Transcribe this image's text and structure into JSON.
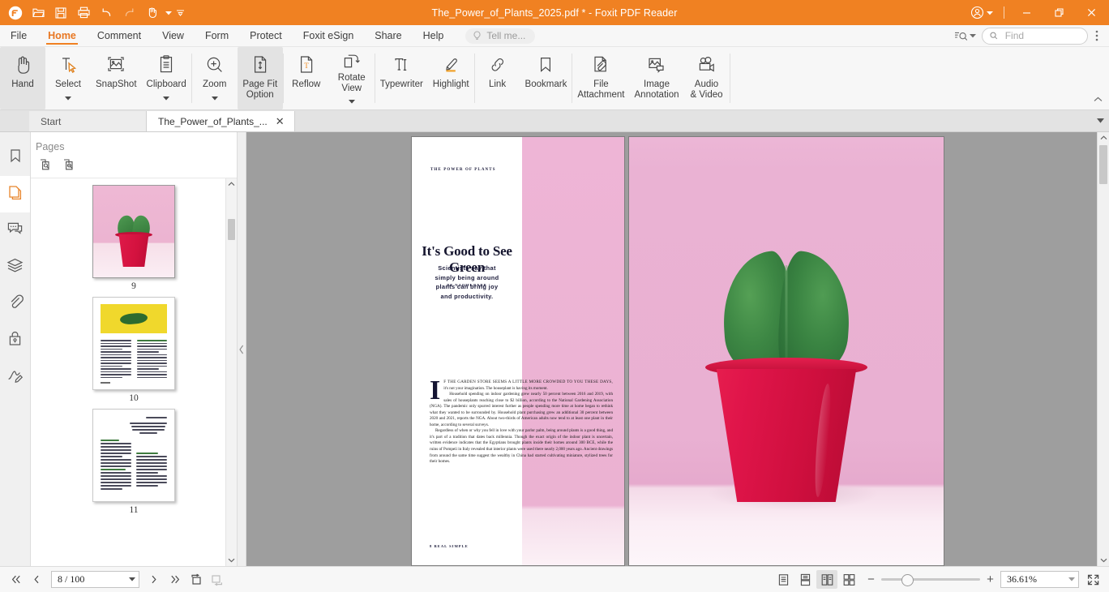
{
  "titlebar": {
    "doc_title": "The_Power_of_Plants_2025.pdf * - Foxit PDF Reader",
    "accent_color": "#f08122",
    "quick_access": [
      {
        "name": "foxit-logo-icon",
        "label": "Foxit"
      },
      {
        "name": "open-icon",
        "label": "Open"
      },
      {
        "name": "save-icon",
        "label": "Save"
      },
      {
        "name": "print-icon",
        "label": "Print"
      },
      {
        "name": "undo-icon",
        "label": "Undo"
      },
      {
        "name": "redo-icon",
        "label": "Redo"
      },
      {
        "name": "hand-tool-icon",
        "label": "Hand Tool"
      },
      {
        "name": "customize-quick-access-icon",
        "label": "Customize"
      }
    ],
    "window_controls": [
      {
        "name": "account-icon",
        "label": "Account"
      },
      {
        "name": "minimize-button",
        "label": "Minimize"
      },
      {
        "name": "restore-button",
        "label": "Restore"
      },
      {
        "name": "close-button",
        "label": "Close"
      }
    ]
  },
  "menubar": {
    "items": [
      {
        "label": "File",
        "active": false
      },
      {
        "label": "Home",
        "active": true
      },
      {
        "label": "Comment",
        "active": false
      },
      {
        "label": "View",
        "active": false
      },
      {
        "label": "Form",
        "active": false
      },
      {
        "label": "Protect",
        "active": false
      },
      {
        "label": "Foxit eSign",
        "active": false
      },
      {
        "label": "Share",
        "active": false
      },
      {
        "label": "Help",
        "active": false
      }
    ],
    "tell_me_placeholder": "Tell me...",
    "find_placeholder": "Find",
    "find_value": ""
  },
  "ribbon": {
    "groups": [
      {
        "buttons": [
          {
            "label": "Hand",
            "icon": "hand-icon",
            "selected": true,
            "caret": false
          },
          {
            "label": "Select",
            "icon": "select-text-icon",
            "selected": false,
            "caret": true
          },
          {
            "label": "SnapShot",
            "icon": "snapshot-icon",
            "selected": false,
            "caret": false
          },
          {
            "label": "Clipboard",
            "icon": "clipboard-icon",
            "selected": false,
            "caret": true
          }
        ]
      },
      {
        "buttons": [
          {
            "label": "Zoom",
            "icon": "zoom-in-icon",
            "selected": false,
            "caret": true
          },
          {
            "label": "Page Fit\nOption",
            "icon": "page-fit-icon",
            "selected": true,
            "caret": true
          }
        ]
      },
      {
        "buttons": [
          {
            "label": "Reflow",
            "icon": "reflow-icon",
            "selected": false,
            "caret": false
          },
          {
            "label": "Rotate\nView",
            "icon": "rotate-view-icon",
            "selected": false,
            "caret": true
          }
        ]
      },
      {
        "buttons": [
          {
            "label": "Typewriter",
            "icon": "typewriter-icon",
            "selected": false,
            "caret": false
          },
          {
            "label": "Highlight",
            "icon": "highlight-icon",
            "selected": false,
            "caret": false
          }
        ]
      },
      {
        "buttons": [
          {
            "label": "Link",
            "icon": "link-icon",
            "selected": false,
            "caret": false
          },
          {
            "label": "Bookmark",
            "icon": "bookmark-icon",
            "selected": false,
            "caret": false
          }
        ]
      },
      {
        "buttons": [
          {
            "label": "File\nAttachment",
            "icon": "file-attachment-icon",
            "selected": false,
            "caret": false
          },
          {
            "label": "Image\nAnnotation",
            "icon": "image-annotation-icon",
            "selected": false,
            "caret": false
          },
          {
            "label": "Audio\n& Video",
            "icon": "audio-video-icon",
            "selected": false,
            "caret": false
          }
        ]
      }
    ]
  },
  "tabs": [
    {
      "label": "Start",
      "active": false,
      "closable": false
    },
    {
      "label": "The_Power_of_Plants_...",
      "active": true,
      "closable": true
    }
  ],
  "navrail": [
    {
      "name": "bookmarks-panel",
      "icon": "bookmark-icon",
      "active": false
    },
    {
      "name": "pages-panel",
      "icon": "pages-icon",
      "active": true
    },
    {
      "name": "comments-panel",
      "icon": "comment-icon",
      "active": false
    },
    {
      "name": "layers-panel",
      "icon": "layers-icon",
      "active": false
    },
    {
      "name": "attachments-panel",
      "icon": "paperclip-icon",
      "active": false
    },
    {
      "name": "security-panel",
      "icon": "lock-icon",
      "active": false
    },
    {
      "name": "signatures-panel",
      "icon": "signature-icon",
      "active": false
    }
  ],
  "pages_panel": {
    "title": "Pages",
    "tools": [
      {
        "name": "enlarge-page-thumbnails-icon"
      },
      {
        "name": "reduce-page-thumbnails-icon"
      }
    ],
    "thumbnails": [
      {
        "number": "9",
        "selected": true,
        "kind": "photo-cactus"
      },
      {
        "number": "10",
        "selected": false,
        "kind": "article-yellow"
      },
      {
        "number": "11",
        "selected": false,
        "kind": "article-text"
      }
    ]
  },
  "document": {
    "left_page": {
      "kicker": "THE POWER OF PLANTS",
      "headline": "It's Good to See Green",
      "dek": "Scientists say that simply being around plants can bring joy and productivity.",
      "byline": "BY NAOMI BARR",
      "dropcap": "I",
      "lead_smallcaps": "F THE GARDEN STORE SEEMS A LITTLE MORE CROWDED TO YOU THESE DAYS,",
      "lead_rest": " it's not your imagination. The houseplant is having its moment.",
      "paragraph_2": "Household spending on indoor gardening grew nearly 50 percent between 2016 and 2019, with sales of houseplants reaching close to $2 billion, according to the National Gardening Association (NGA). The pandemic only spurred interest further as people spending more time at home began to rethink what they wanted to be surrounded by. Household plant purchasing grew an additional 30 percent between 2020 and 2021, reports the NGA. About two-thirds of American adults now tend to at least one plant in their home, according to several surveys.",
      "paragraph_3": "Regardless of when or why you fell in love with your parlor palm, being around plants is a good thing, and it's part of a tradition that dates back millennia. Though the exact origin of the indoor plant is uncertain, written evidence indicates that the Egyptians brought plants inside their homes around 300 BCE, while the ruins of Pompeii in Italy revealed that interior plants were used there nearly 2,000 years ago. Ancient drawings from around the same time suggest the wealthy in China had started cultivating miniature, stylized trees for their homes.",
      "footer": "8  REAL SIMPLE"
    },
    "right_page": {
      "alt": "Heart-shaped hoya plant in a crimson pot on a pink background"
    }
  },
  "statusbar": {
    "first_page_label": "First Page",
    "prev_page_label": "Previous Page",
    "page_value": "8 / 100",
    "next_page_label": "Next Page",
    "last_page_label": "Last Page",
    "rotate_label": "Rotate",
    "flip_label": "Flip",
    "view_modes": [
      {
        "name": "single-page-view",
        "selected": false
      },
      {
        "name": "continuous-scroll-view",
        "selected": false
      },
      {
        "name": "facing-page-view",
        "selected": true
      },
      {
        "name": "continuous-facing-view",
        "selected": false
      }
    ],
    "zoom_out_label": "−",
    "zoom_in_label": "+",
    "zoom_value": "36.61%",
    "fullscreen_label": "Full Screen"
  }
}
